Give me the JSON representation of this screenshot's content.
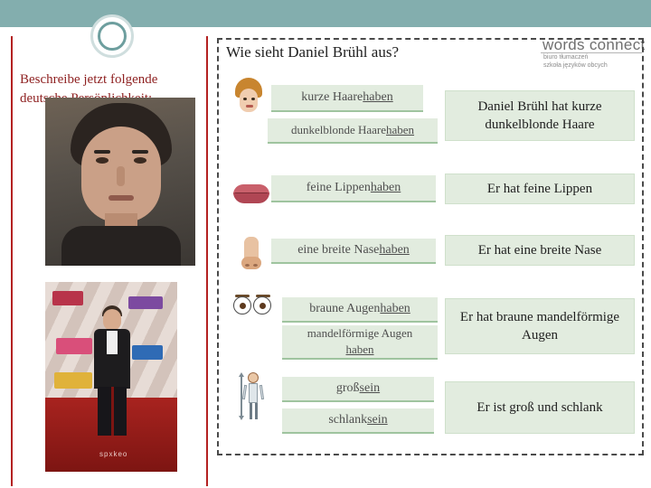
{
  "slide": {
    "left_prompt": "Beschreibe jetzt folgende deutsche Persönlichkeit:",
    "question": "Wie sieht Daniel Brühl aus?",
    "photo1_alt": "Portraitfoto Daniel Brühl",
    "photo2_alt": "Daniel Brühl auf dem roten Teppich",
    "photo2_watermark": "spxkeo"
  },
  "logo": {
    "title": "words connect",
    "sub1": "biuro tłumaczeń",
    "sub2": "szkoła języków obcych"
  },
  "phrases": [
    {
      "text": "kurze Haare ",
      "verb": "haben",
      "icon": "hair-icon"
    },
    {
      "text": "dunkelblonde Haare ",
      "verb": "haben",
      "icon": ""
    },
    {
      "text": "feine Lippen ",
      "verb": "haben",
      "icon": "lips-icon"
    },
    {
      "text": "eine breite Nase ",
      "verb": "haben",
      "icon": "nose-icon"
    },
    {
      "text": "braune Augen ",
      "verb": "haben",
      "icon": "eyes-icon"
    },
    {
      "text": "mandelförmige Augen ",
      "verb": "haben",
      "icon": ""
    },
    {
      "text": "groß ",
      "verb": "sein",
      "icon": "body-icon"
    },
    {
      "text": "schlank ",
      "verb": "sein",
      "icon": ""
    }
  ],
  "answers": [
    "Daniel Brühl hat kurze dunkelblonde Haare",
    "Er hat feine Lippen",
    "Er hat eine breite Nase",
    "Er hat braune mandelförmige Augen",
    "Er ist groß und schlank"
  ],
  "colors": {
    "top_bar": "#83aeae",
    "rule_red": "#b42121",
    "pill_bg": "#e2ecdf",
    "pill_underline": "#9fc49f",
    "prompt_text": "#8f2222"
  }
}
